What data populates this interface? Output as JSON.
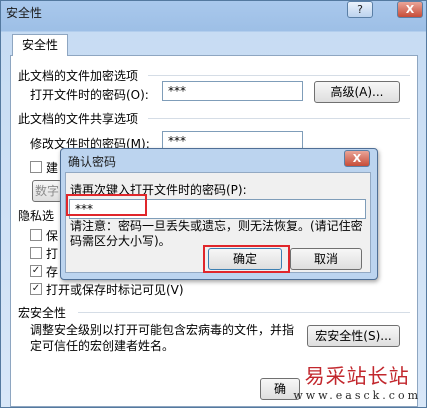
{
  "window": {
    "title": "安全性",
    "help_button": "?",
    "close_button": "X"
  },
  "tab": {
    "label": "安全性"
  },
  "encrypt": {
    "heading": "此文档的文件加密选项",
    "open_password_label": "打开文件时的密码(O):",
    "open_password_value": "***",
    "advanced_button": "高级(A)..."
  },
  "share": {
    "heading": "此文档的文件共享选项",
    "modify_password_label": "修改文件时的密码(M):",
    "modify_password_value": "***",
    "recommend_readonly_partial": "建",
    "digital_signature_partial": "数字"
  },
  "privacy": {
    "heading_partial": "隐私选",
    "items": [
      {
        "label": "保",
        "checked": false
      },
      {
        "label": "打",
        "checked": false
      },
      {
        "label": "存",
        "checked": true
      },
      {
        "label": "打开或保存时标记可见(V)",
        "checked": true
      }
    ]
  },
  "macro": {
    "heading": "宏安全性",
    "description": "调整安全级别以打开可能包含宏病毒的文件，并指定可信任的宏创建者姓名。",
    "button": "宏安全性(S)..."
  },
  "bottom": {
    "ok_partial": "确"
  },
  "dialog": {
    "title": "确认密码",
    "close_button": "X",
    "prompt": "请再次键入打开文件时的密码(P):",
    "value": "***",
    "note": "请注意：密码一旦丢失或遗忘，则无法恢复。(请记住密码需区分大小写)。",
    "ok_button": "确定",
    "cancel_button": "取消"
  },
  "watermark": {
    "text": "易采站长站",
    "url": "www.easck.com"
  },
  "colors": {
    "highlight_red": "#e0262b",
    "watermark_red": "#c2272d"
  }
}
